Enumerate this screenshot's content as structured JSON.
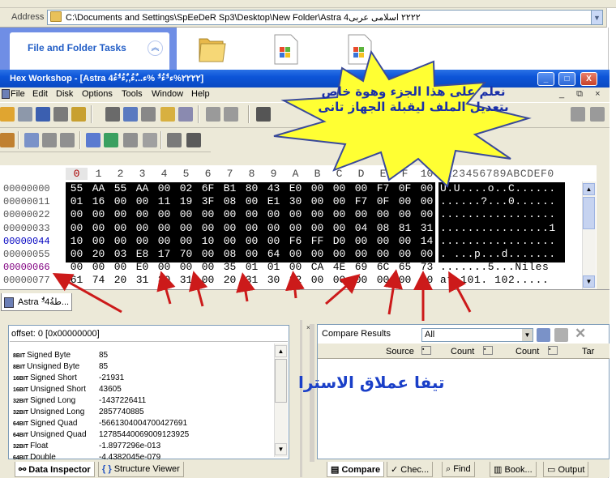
{
  "explorer": {
    "address_label": "Address",
    "address_path": "C:\\Documents and Settings\\SpEeDeR Sp3\\Desktop\\New Folder\\Astra ٢٢٢٢ اسلامى عربى4",
    "tasks_title": "File and Folder Tasks"
  },
  "window": {
    "title": "Hex Workshop - [Astra ٢٢٢٢%ء³ُءُ³ُ %ء...ٌءُ,,ٌءُ³ُءُ4]",
    "min_label": "_",
    "max_label": "□",
    "close_label": "X"
  },
  "menu": [
    "File",
    "Edit",
    "Disk",
    "Options",
    "Tools",
    "Window",
    "Help"
  ],
  "mdi_controls": "_ ⧉ ×",
  "hex": {
    "columns": [
      "0",
      "1",
      "2",
      "3",
      "4",
      "5",
      "6",
      "7",
      "8",
      "9",
      "A",
      "B",
      "C",
      "D",
      "E",
      "F",
      "10"
    ],
    "ascii_header": "0123456789ABCDEF0",
    "rows": [
      {
        "offset": "00000000",
        "bytes": [
          "55",
          "AA",
          "55",
          "AA",
          "00",
          "02",
          "6F",
          "B1",
          "80",
          "43",
          "E0",
          "00",
          "00",
          "00",
          "F7",
          "0F",
          "00"
        ],
        "ascii": "U.U....o..C......"
      },
      {
        "offset": "00000011",
        "bytes": [
          "01",
          "16",
          "00",
          "00",
          "11",
          "19",
          "3F",
          "08",
          "00",
          "E1",
          "30",
          "00",
          "00",
          "F7",
          "0F",
          "00",
          "00"
        ],
        "ascii": "......?...0......"
      },
      {
        "offset": "00000022",
        "bytes": [
          "00",
          "00",
          "00",
          "00",
          "00",
          "00",
          "00",
          "00",
          "00",
          "00",
          "00",
          "00",
          "00",
          "00",
          "00",
          "00",
          "00"
        ],
        "ascii": "................."
      },
      {
        "offset": "00000033",
        "bytes": [
          "00",
          "00",
          "00",
          "00",
          "00",
          "00",
          "00",
          "00",
          "00",
          "00",
          "00",
          "00",
          "00",
          "04",
          "08",
          "81",
          "31"
        ],
        "ascii": "................1"
      },
      {
        "offset": "00000044",
        "bytes": [
          "10",
          "00",
          "00",
          "00",
          "00",
          "00",
          "10",
          "00",
          "00",
          "00",
          "F6",
          "FF",
          "D0",
          "00",
          "00",
          "00",
          "14"
        ],
        "ascii": "................."
      },
      {
        "offset": "00000055",
        "bytes": [
          "00",
          "20",
          "03",
          "E8",
          "17",
          "70",
          "00",
          "08",
          "00",
          "64",
          "00",
          "00",
          "00",
          "00",
          "00",
          "00",
          "00"
        ],
        "ascii": ". ...p...d......."
      },
      {
        "offset": "00000066",
        "bytes": [
          "00",
          "00",
          "00",
          "E0",
          "00",
          "00",
          "00",
          "35",
          "01",
          "01",
          "00",
          "CA",
          "4E",
          "69",
          "6C",
          "65",
          "73"
        ],
        "ascii": ".......5...Niles"
      },
      {
        "offset": "00000077",
        "bytes": [
          "61",
          "74",
          "20",
          "31",
          "30",
          "31",
          "00",
          "20",
          "31",
          "30",
          "32",
          "00",
          "00",
          "00",
          "00",
          "00",
          "00"
        ],
        "ascii": "at 101. 102....."
      }
    ]
  },
  "doc_tab": "Astra ³ُطةُ4...",
  "inspector": {
    "offset_label": "offset: 0 [0x00000000]",
    "rows": [
      {
        "bits": "8BIT",
        "type": "Signed Byte",
        "value": "85"
      },
      {
        "bits": "8BIT",
        "type": "Unsigned Byte",
        "value": "85"
      },
      {
        "bits": "16BIT",
        "type": "Signed Short",
        "value": "-21931"
      },
      {
        "bits": "16BIT",
        "type": "Unsigned Short",
        "value": "43605"
      },
      {
        "bits": "32BIT",
        "type": "Signed Long",
        "value": "-1437226411"
      },
      {
        "bits": "32BIT",
        "type": "Unsigned Long",
        "value": "2857740885"
      },
      {
        "bits": "64BIT",
        "type": "Signed Quad",
        "value": "-5661304004700427691"
      },
      {
        "bits": "64BIT",
        "type": "Unsigned Quad",
        "value": "12785440069009123925"
      },
      {
        "bits": "32BIT",
        "type": "Float",
        "value": "-1.8977296e-013"
      },
      {
        "bits": "64BIT",
        "type": "Double",
        "value": "-4.4382045e-079"
      }
    ]
  },
  "compare": {
    "title": "Compare Results",
    "select_value": "All",
    "columns": [
      "Source",
      "Count",
      "Count",
      "Tar"
    ]
  },
  "overlay_text": "تيفا عملاق الاسترا",
  "callout_text": "نعلم على هذا الجزء وهوة خاص بتعديل الملف ليقبلة الجهاز تانى",
  "bottom_tabs": {
    "data_inspector": "Data Inspector",
    "structure_viewer": "Structure Viewer",
    "compare": "Compare",
    "checksum": "Chec...",
    "find": "Find",
    "bookmarks": "Book...",
    "output": "Output"
  },
  "colors": {
    "titlebar": "#0a49c2",
    "callout_fill": "#ffff33",
    "arrow": "#cc1a1a",
    "overlay_text": "#1a3fc8"
  }
}
